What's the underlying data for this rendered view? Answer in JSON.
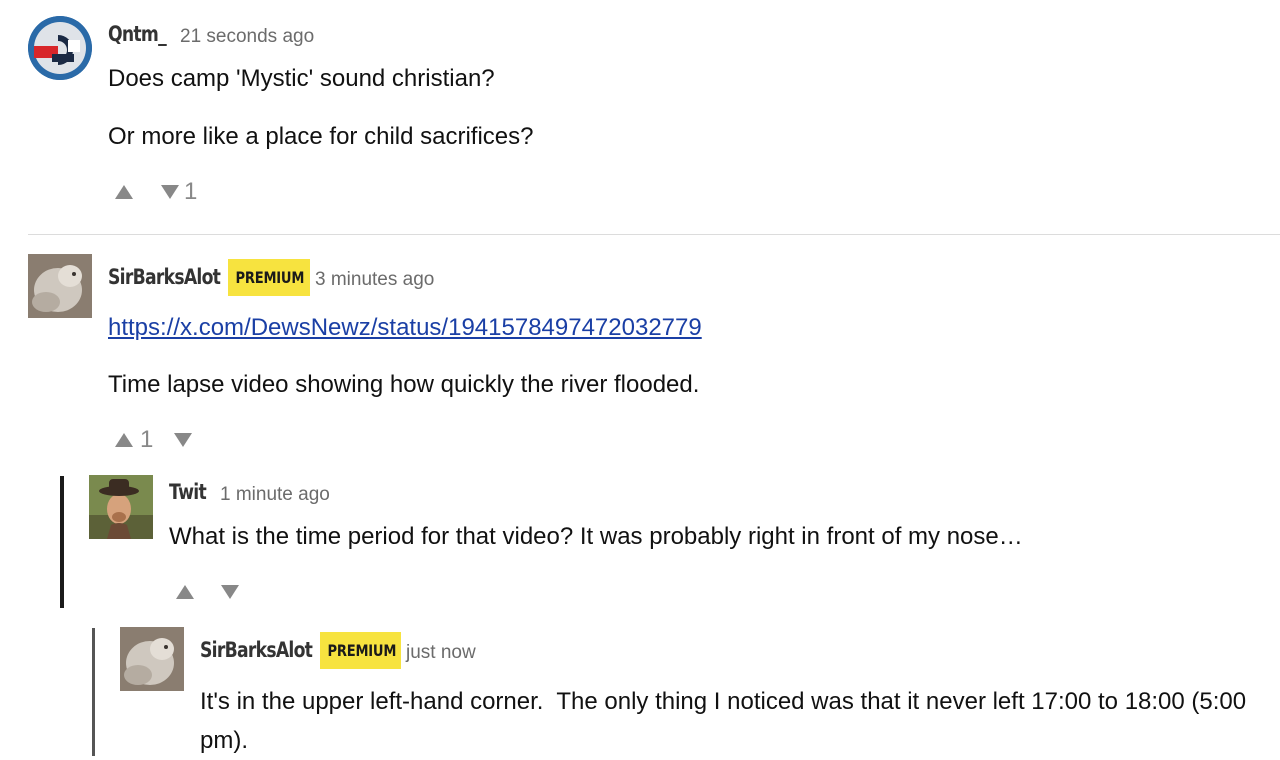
{
  "comments": [
    {
      "username": "Qntm_",
      "time": "21 seconds ago",
      "paragraphs": [
        "Does camp 'Mystic' sound christian?",
        "Or more like a place for child sacrifices?"
      ],
      "upvotes": "",
      "downvotes": "1"
    },
    {
      "username": "SirBarksAlot",
      "badge": "PREMIUM",
      "time": "3 minutes ago",
      "link": "https://x.com/DewsNewz/status/1941578497472032779",
      "paragraphs": [
        "Time lapse video showing how quickly the river flooded."
      ],
      "upvotes": "1",
      "downvotes": ""
    },
    {
      "username": "Twit",
      "time": "1 minute ago",
      "paragraphs": [
        "What is the time period for that video? It was probably right in front of my nose…"
      ],
      "upvotes": "",
      "downvotes": ""
    },
    {
      "username": "SirBarksAlot",
      "badge": "PREMIUM",
      "time": "just now",
      "paragraphs": [
        "It's in the upper left-hand corner.  The only thing I noticed was that it never left 17:00 to 18:00 (5:00 pm)."
      ]
    }
  ],
  "icons": {
    "upvote": "triangle-up-icon",
    "downvote": "triangle-down-icon"
  },
  "colors": {
    "premium_badge": "#f7e33f",
    "link": "#1a3fa5",
    "vote_icon": "#888888"
  }
}
